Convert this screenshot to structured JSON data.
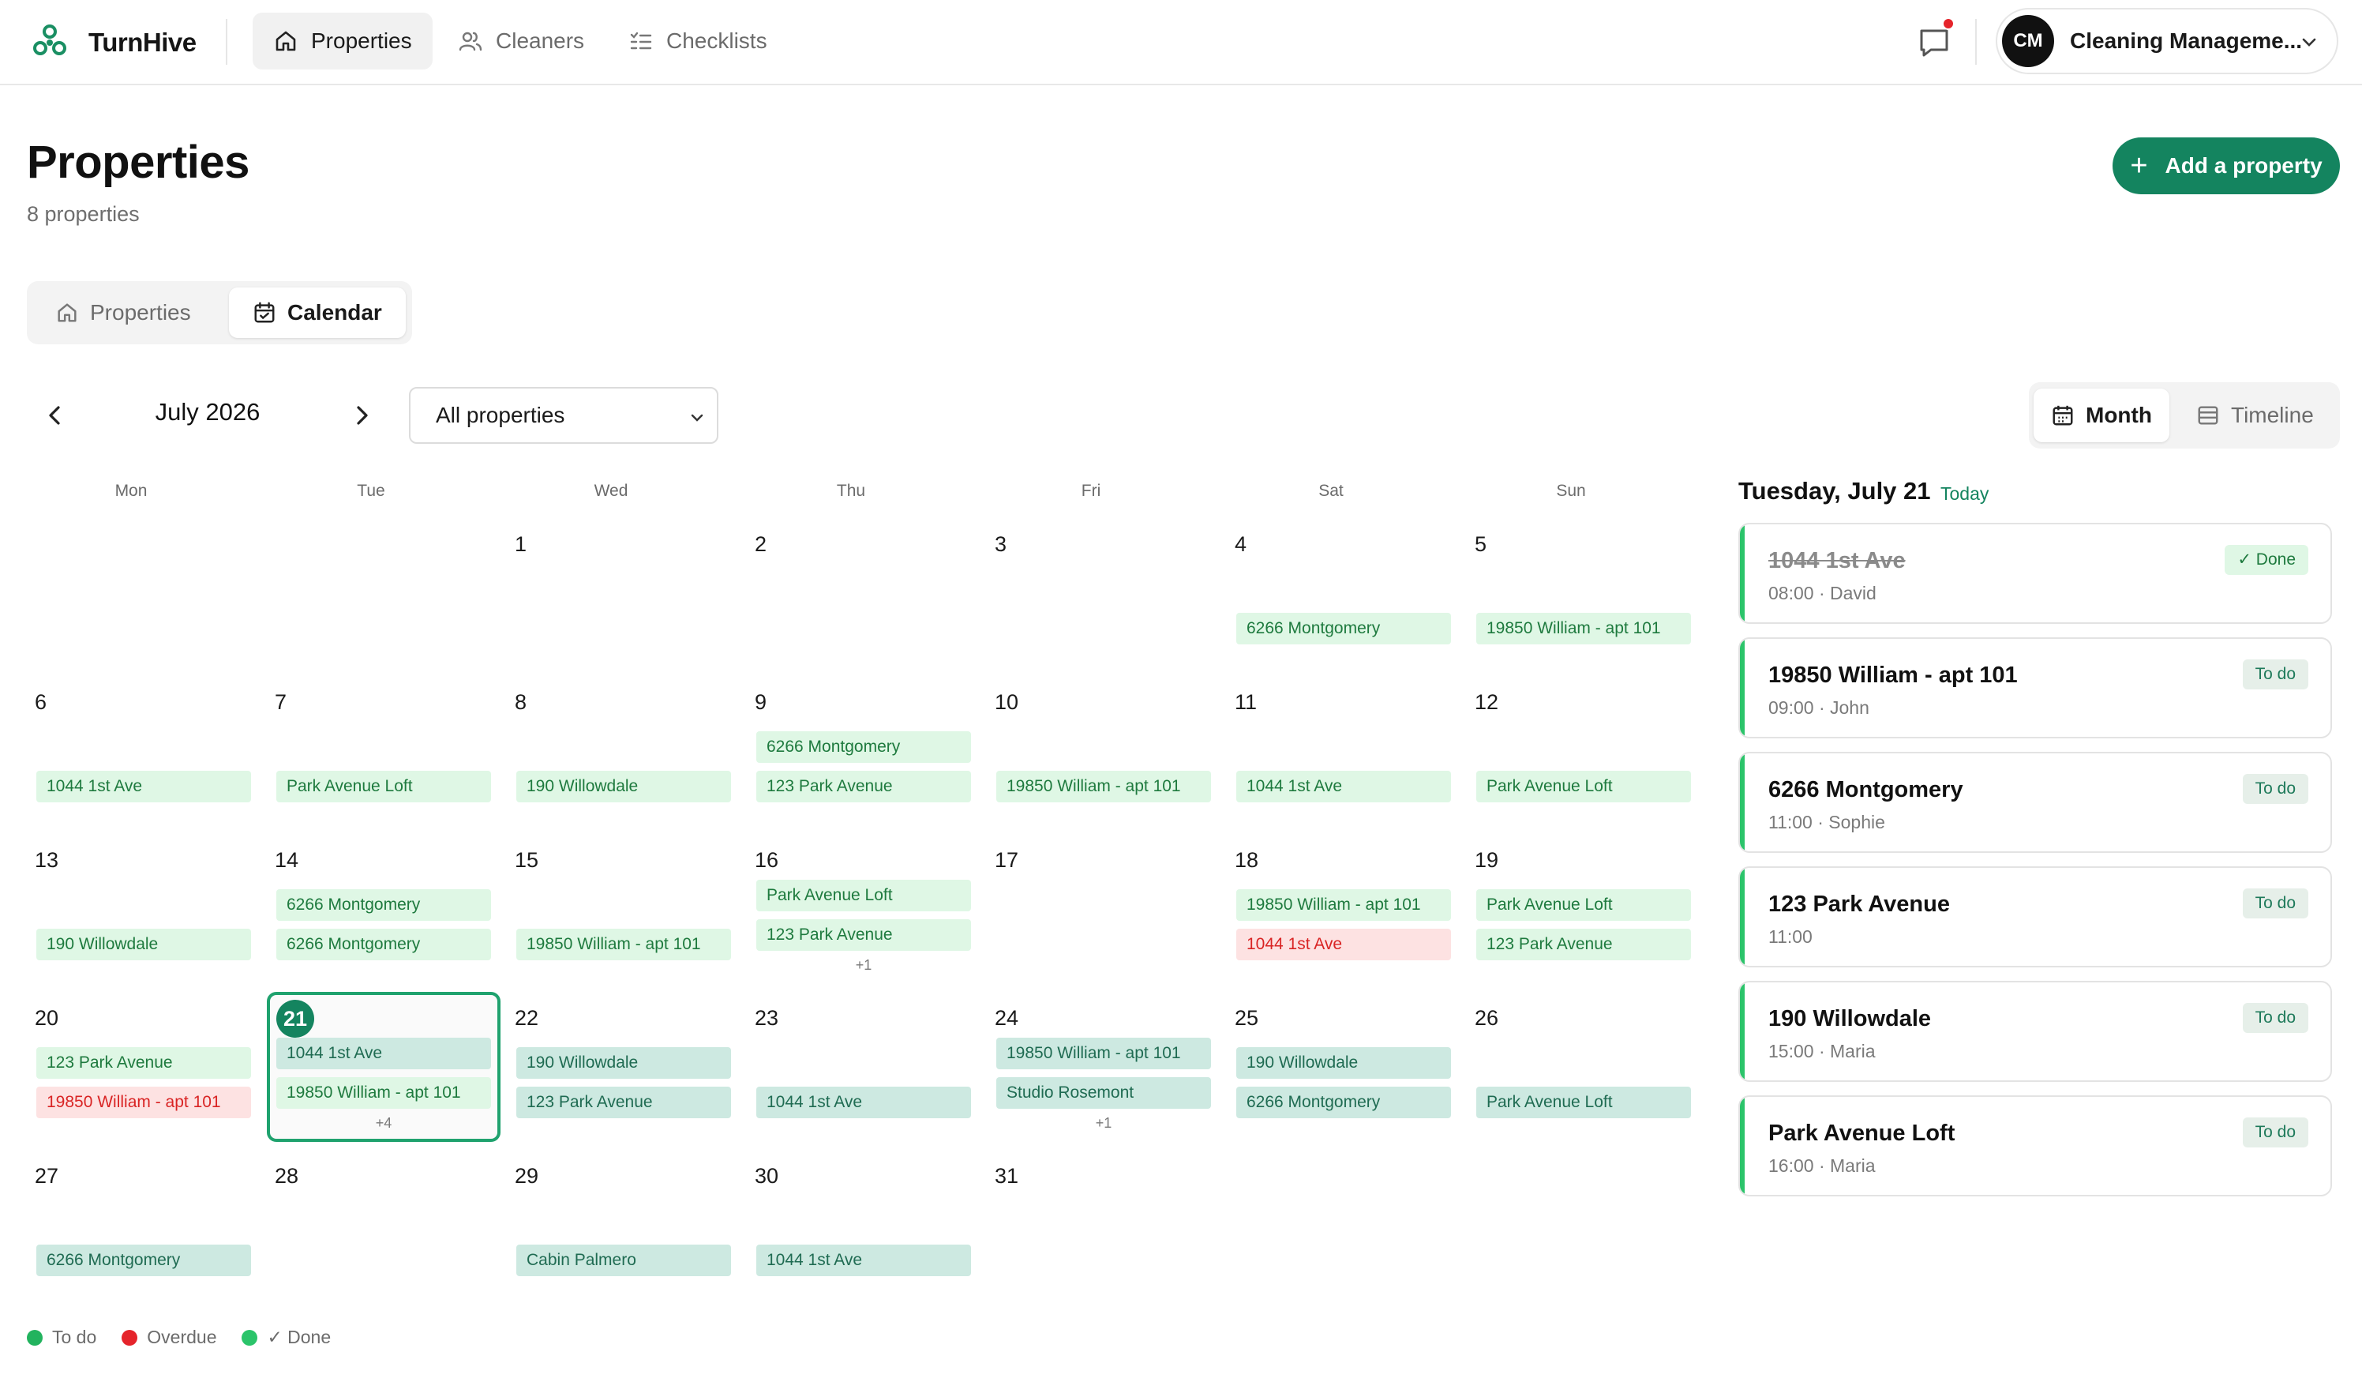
{
  "app": {
    "name": "TurnHive"
  },
  "nav": {
    "tabs": [
      {
        "label": "Properties",
        "icon": "home-icon",
        "active": true
      },
      {
        "label": "Cleaners",
        "icon": "users-icon",
        "active": false
      },
      {
        "label": "Checklists",
        "icon": "checklist-icon",
        "active": false
      }
    ],
    "account": {
      "initials": "CM",
      "name": "Cleaning Manageme..."
    }
  },
  "page": {
    "title": "Properties",
    "count_label": "8 properties",
    "add_button": "Add a property",
    "view_tabs": [
      {
        "label": "Properties",
        "icon": "home-icon",
        "active": false
      },
      {
        "label": "Calendar",
        "icon": "calendar-icon",
        "active": true
      }
    ]
  },
  "calendar": {
    "month_label": "July 2026",
    "filter_value": "All properties",
    "view_modes": [
      {
        "label": "Month",
        "icon": "calendar-icon",
        "active": true
      },
      {
        "label": "Timeline",
        "icon": "timeline-icon",
        "active": false
      }
    ],
    "weekdays": [
      "Mon",
      "Tue",
      "Wed",
      "Thu",
      "Fri",
      "Sat",
      "Sun"
    ],
    "weeks": [
      [
        {
          "day": null,
          "chips": []
        },
        {
          "day": null,
          "chips": []
        },
        {
          "day": "1",
          "chips": []
        },
        {
          "day": "2",
          "chips": []
        },
        {
          "day": "3",
          "chips": []
        },
        {
          "day": "4",
          "chips": [
            {
              "label": "6266 Montgomery",
              "status": "todo"
            }
          ]
        },
        {
          "day": "5",
          "chips": [
            {
              "label": "19850 William - apt 101",
              "status": "todo"
            }
          ]
        }
      ],
      [
        {
          "day": "6",
          "chips": [
            {
              "label": "1044 1st Ave",
              "status": "todo"
            }
          ]
        },
        {
          "day": "7",
          "chips": [
            {
              "label": "Park Avenue Loft",
              "status": "todo"
            }
          ]
        },
        {
          "day": "8",
          "chips": [
            {
              "label": "190 Willowdale",
              "status": "todo"
            }
          ]
        },
        {
          "day": "9",
          "chips": [
            {
              "label": "6266 Montgomery",
              "status": "todo"
            },
            {
              "label": "123 Park Avenue",
              "status": "todo"
            }
          ]
        },
        {
          "day": "10",
          "chips": [
            {
              "label": "19850 William - apt 101",
              "status": "todo"
            }
          ]
        },
        {
          "day": "11",
          "chips": [
            {
              "label": "1044 1st Ave",
              "status": "todo"
            }
          ]
        },
        {
          "day": "12",
          "chips": [
            {
              "label": "Park Avenue Loft",
              "status": "todo"
            }
          ]
        }
      ],
      [
        {
          "day": "13",
          "chips": [
            {
              "label": "190 Willowdale",
              "status": "todo"
            }
          ]
        },
        {
          "day": "14",
          "chips": [
            {
              "label": "6266 Montgomery",
              "status": "todo"
            },
            {
              "label": "6266 Montgomery",
              "status": "todo"
            }
          ]
        },
        {
          "day": "15",
          "chips": [
            {
              "label": "19850 William - apt 101",
              "status": "todo"
            }
          ]
        },
        {
          "day": "16",
          "chips": [
            {
              "label": "Park Avenue Loft",
              "status": "todo"
            },
            {
              "label": "123 Park Avenue",
              "status": "todo"
            }
          ],
          "more": "+1"
        },
        {
          "day": "17",
          "chips": []
        },
        {
          "day": "18",
          "chips": [
            {
              "label": "19850 William - apt 101",
              "status": "todo"
            },
            {
              "label": "1044 1st Ave",
              "status": "overdue"
            }
          ]
        },
        {
          "day": "19",
          "chips": [
            {
              "label": "Park Avenue Loft",
              "status": "todo"
            },
            {
              "label": "123 Park Avenue",
              "status": "todo"
            }
          ]
        }
      ],
      [
        {
          "day": "20",
          "chips": [
            {
              "label": "123 Park Avenue",
              "status": "todo"
            },
            {
              "label": "19850 William - apt 101",
              "status": "overdue"
            }
          ]
        },
        {
          "day": "21",
          "today": true,
          "chips": [
            {
              "label": "1044 1st Ave",
              "status": "done"
            },
            {
              "label": "19850 William - apt 101",
              "status": "todo"
            }
          ],
          "more": "+4"
        },
        {
          "day": "22",
          "chips": [
            {
              "label": "190 Willowdale",
              "status": "done"
            },
            {
              "label": "123 Park Avenue",
              "status": "done"
            }
          ]
        },
        {
          "day": "23",
          "chips": [
            {
              "label": "1044 1st Ave",
              "status": "done"
            }
          ]
        },
        {
          "day": "24",
          "chips": [
            {
              "label": "19850 William - apt 101",
              "status": "done"
            },
            {
              "label": "Studio Rosemont",
              "status": "done"
            }
          ],
          "more": "+1"
        },
        {
          "day": "25",
          "chips": [
            {
              "label": "190 Willowdale",
              "status": "done"
            },
            {
              "label": "6266 Montgomery",
              "status": "done"
            }
          ]
        },
        {
          "day": "26",
          "chips": [
            {
              "label": "Park Avenue Loft",
              "status": "done"
            }
          ]
        }
      ],
      [
        {
          "day": "27",
          "chips": [
            {
              "label": "6266 Montgomery",
              "status": "done"
            }
          ]
        },
        {
          "day": "28",
          "chips": []
        },
        {
          "day": "29",
          "chips": [
            {
              "label": "Cabin Palmero",
              "status": "done"
            }
          ]
        },
        {
          "day": "30",
          "chips": [
            {
              "label": "1044 1st Ave",
              "status": "done"
            }
          ]
        },
        {
          "day": "31",
          "chips": []
        },
        {
          "day": null,
          "chips": []
        },
        {
          "day": null,
          "chips": []
        }
      ]
    ]
  },
  "legend": [
    {
      "label": "To do",
      "color": "#22b35e"
    },
    {
      "label": "Overdue",
      "color": "#e5242b"
    },
    {
      "label": "✓ Done",
      "color": "#2bc46a"
    }
  ],
  "day_panel": {
    "date_label": "Tuesday, July 21",
    "today_label": "Today",
    "tasks": [
      {
        "title": "1044 1st Ave",
        "meta": "08:00 · David",
        "status": "done",
        "badge": "✓ Done"
      },
      {
        "title": "19850 William - apt 101",
        "meta": "09:00 · John",
        "status": "todo",
        "badge": "To do"
      },
      {
        "title": "6266 Montgomery",
        "meta": "11:00 · Sophie",
        "status": "todo",
        "badge": "To do"
      },
      {
        "title": "123 Park Avenue",
        "meta": "11:00",
        "status": "todo",
        "badge": "To do"
      },
      {
        "title": "190 Willowdale",
        "meta": "15:00 · Maria",
        "status": "todo",
        "badge": "To do"
      },
      {
        "title": "Park Avenue Loft",
        "meta": "16:00 · Maria",
        "status": "todo",
        "badge": "To do"
      }
    ]
  },
  "colors": {
    "brand": "#14845f",
    "todo_chip_bg": "#dff7e5",
    "overdue_chip_bg": "#fde2e2",
    "done_chip_bg": "#cde9e1"
  }
}
